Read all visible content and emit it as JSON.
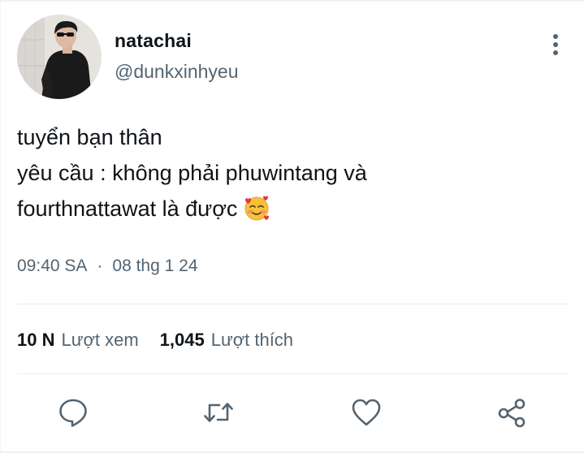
{
  "user": {
    "display_name": "natachai",
    "handle": "@dunkxinhyeu",
    "avatar_icon": "profile-photo"
  },
  "tweet": {
    "lines": [
      "tuyển bạn thân",
      "yêu cầu : không phải phuwintang và",
      "fourthnattawat là được"
    ],
    "emoji": "smiling-face-with-hearts"
  },
  "meta": {
    "time": "09:40 SA",
    "separator": "·",
    "date": "08 thg 1 24"
  },
  "stats": {
    "views_count": "10 N",
    "views_label": "Lượt xem",
    "likes_count": "1,045",
    "likes_label": "Lượt thích"
  },
  "actions": {
    "reply_icon": "comment-icon",
    "retweet_icon": "retweet-icon",
    "like_icon": "heart-icon",
    "share_icon": "share-icon"
  },
  "colors": {
    "text_primary": "#0f1419",
    "text_secondary": "#536471",
    "icon_gray": "#536471",
    "divider": "#e8ebed"
  }
}
